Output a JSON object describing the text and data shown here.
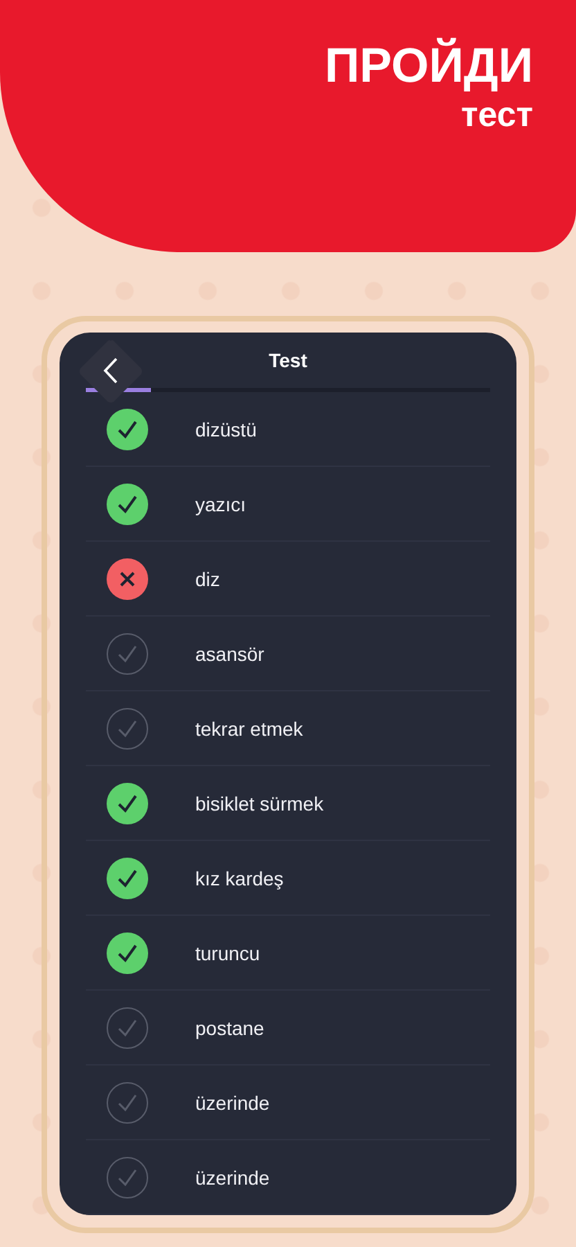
{
  "headline": {
    "title": "ПРОЙДИ",
    "subtitle": "тест"
  },
  "screen": {
    "title": "Test",
    "progress": {
      "level": 0.16
    },
    "answers": [
      {
        "word": "dizüstü",
        "kind": "correct"
      },
      {
        "word": "yazıcı",
        "kind": "correct"
      },
      {
        "word": "diz",
        "kind": "wrong"
      },
      {
        "word": "asansör",
        "kind": "pending"
      },
      {
        "word": "tekrar etmek",
        "kind": "pending"
      },
      {
        "word": "bisiklet sürmek",
        "kind": "correct"
      },
      {
        "word": "kız kardeş",
        "kind": "correct"
      },
      {
        "word": "turuncu",
        "kind": "correct"
      },
      {
        "word": "postane",
        "kind": "pending"
      },
      {
        "word": "üzerinde",
        "kind": "pending"
      },
      {
        "word": "üzerinde",
        "kind": "pending"
      }
    ]
  }
}
